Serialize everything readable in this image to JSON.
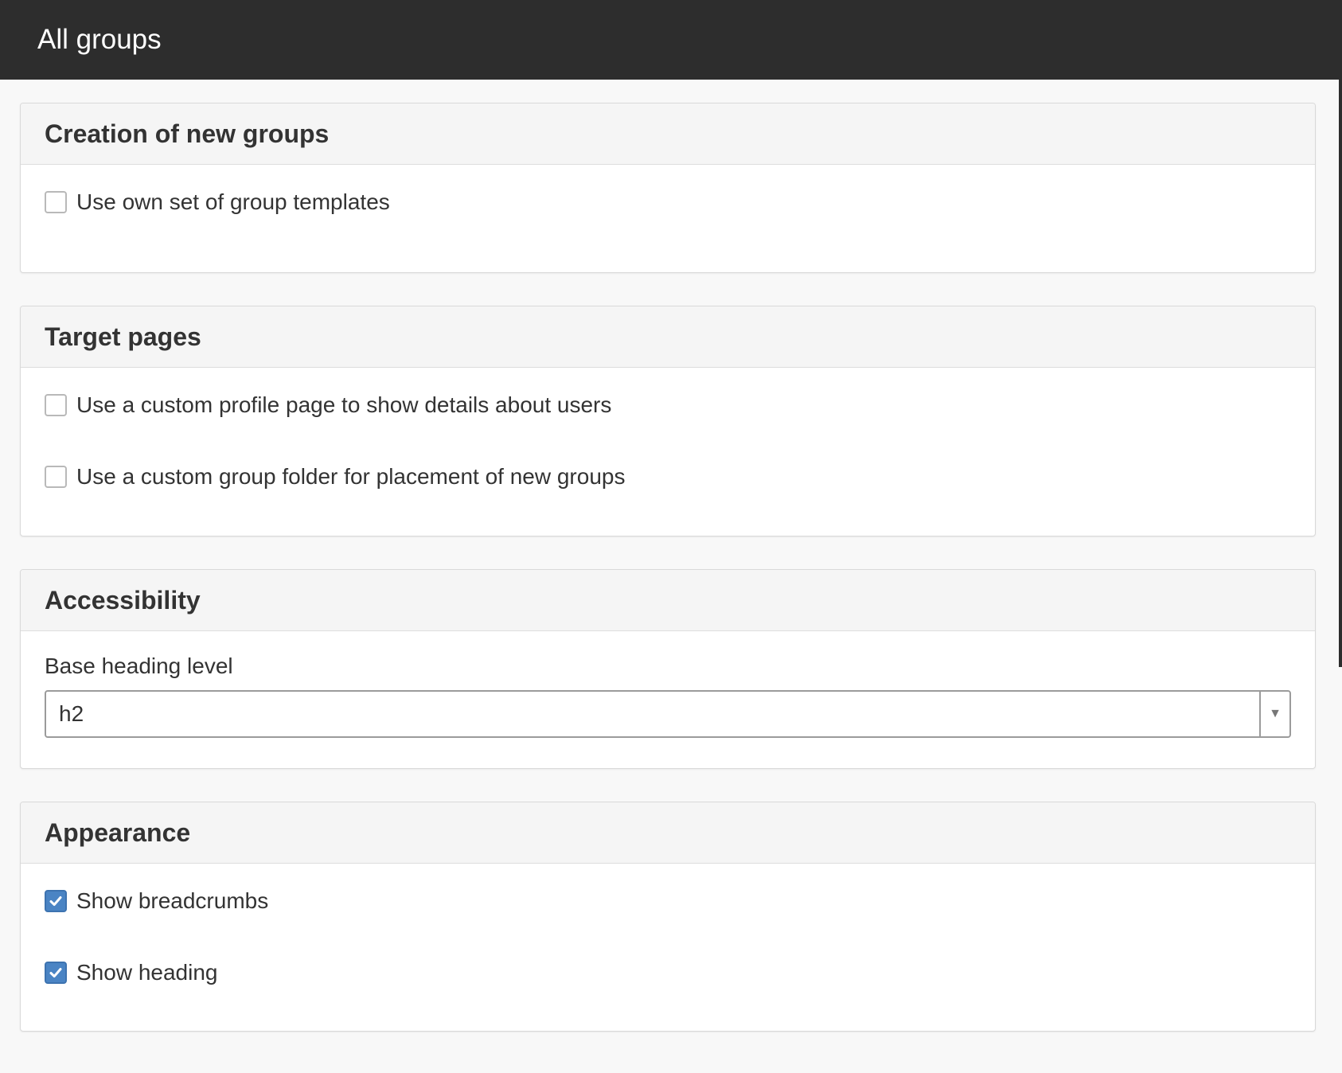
{
  "header": {
    "title": "All groups"
  },
  "panels": {
    "creation": {
      "title": "Creation of new groups",
      "options": [
        {
          "label": "Use own set of group templates",
          "checked": false
        }
      ]
    },
    "target": {
      "title": "Target pages",
      "options": [
        {
          "label": "Use a custom profile page to show details about users",
          "checked": false
        },
        {
          "label": "Use a custom group folder for placement of new groups",
          "checked": false
        }
      ]
    },
    "accessibility": {
      "title": "Accessibility",
      "heading_level_label": "Base heading level",
      "heading_level_value": "h2",
      "dropdown_icon": "triangle-down"
    },
    "appearance": {
      "title": "Appearance",
      "options": [
        {
          "label": "Show breadcrumbs",
          "checked": true
        },
        {
          "label": "Show heading",
          "checked": true
        }
      ]
    }
  },
  "colors": {
    "header_bg": "#2d2d2d",
    "checkbox_checked": "#4a84c4",
    "page_bg": "#f8f8f8"
  }
}
